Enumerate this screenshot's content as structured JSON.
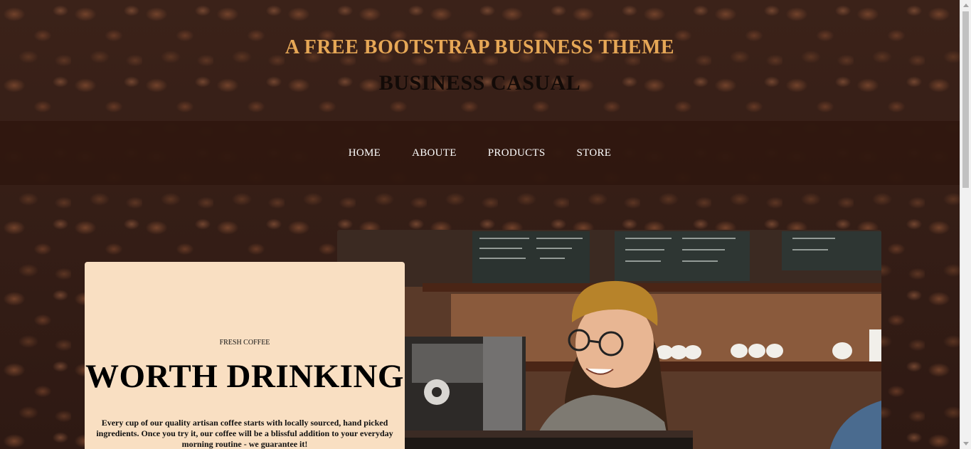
{
  "header": {
    "upper": "A FREE BOOTSTRAP BUSINESS THEME",
    "lower": "BUSINESS CASUAL"
  },
  "nav": {
    "items": [
      {
        "label": "HOME"
      },
      {
        "label": "ABOUTE"
      },
      {
        "label": "PRODUCTS"
      },
      {
        "label": "STORE"
      }
    ]
  },
  "intro": {
    "upper": "FRESH COFFEE",
    "lower": "WORTH DRINKING",
    "body": "Every cup of our quality artisan coffee starts with locally sourced, hand picked ingredients. Once you try it, our coffee will be a blissful addition to your everyday morning routine - we guarantee it!"
  },
  "colors": {
    "accent": "#e6a756",
    "navbar": "#2f170f",
    "intro_bg": "#f9dfc2"
  }
}
